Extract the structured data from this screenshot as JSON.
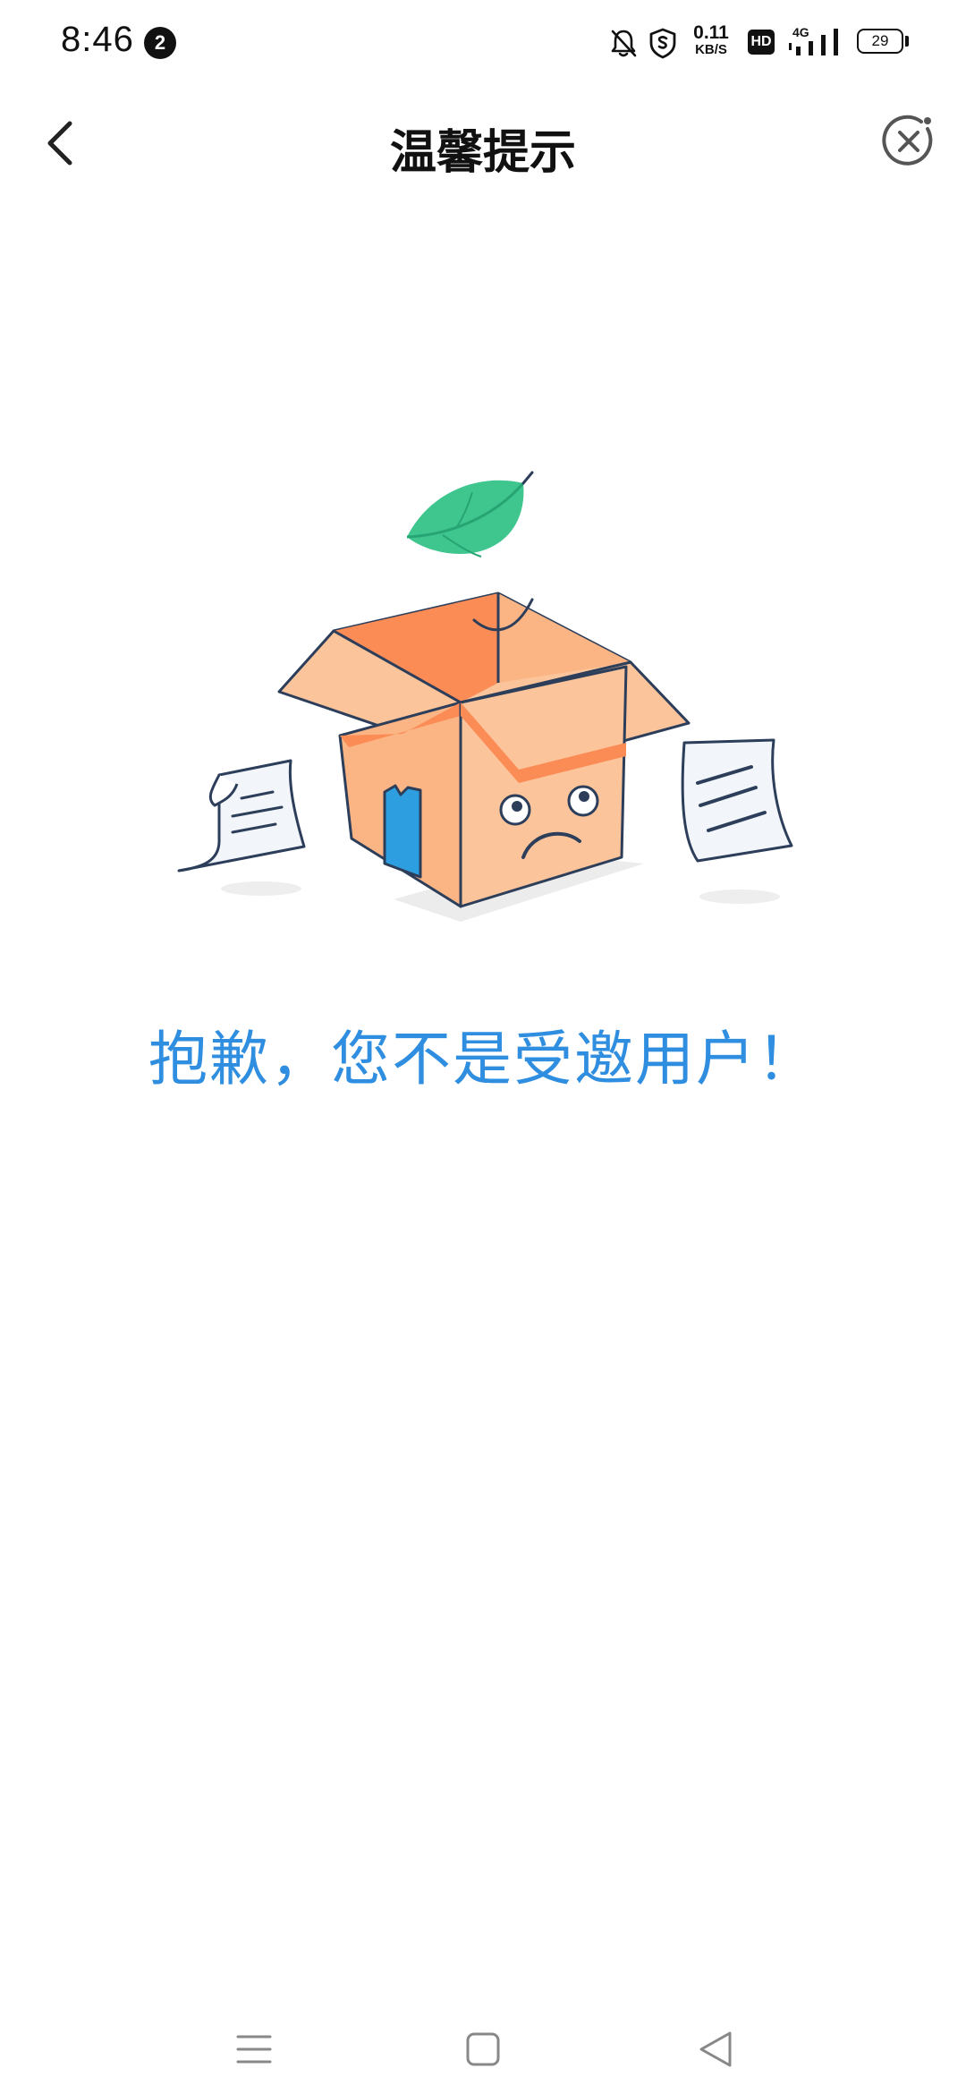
{
  "status_bar": {
    "time": "8:46",
    "notification_count": "2",
    "net_speed_value": "0.11",
    "net_speed_unit": "KB/S",
    "hd_label": "HD",
    "network_type": "4G",
    "battery_level": "29",
    "icons": [
      "bell-muted-icon",
      "shield-s-icon",
      "signal-icon",
      "battery-icon"
    ]
  },
  "header": {
    "title": "温馨提示",
    "back_icon": "chevron-left-icon",
    "close_icon": "close-circle-icon"
  },
  "main": {
    "illustration": "sad-empty-box-icon",
    "message": "抱歉，您不是受邀用户！"
  },
  "nav_bar": {
    "icons": [
      "menu-icon",
      "home-square-icon",
      "back-triangle-icon"
    ]
  },
  "colors": {
    "message_blue": "#2f8ee0",
    "box_peach": "#fbc49a",
    "box_orange": "#fb8c56",
    "leaf_green": "#3fc58e",
    "outline_navy": "#2c3e5a"
  }
}
